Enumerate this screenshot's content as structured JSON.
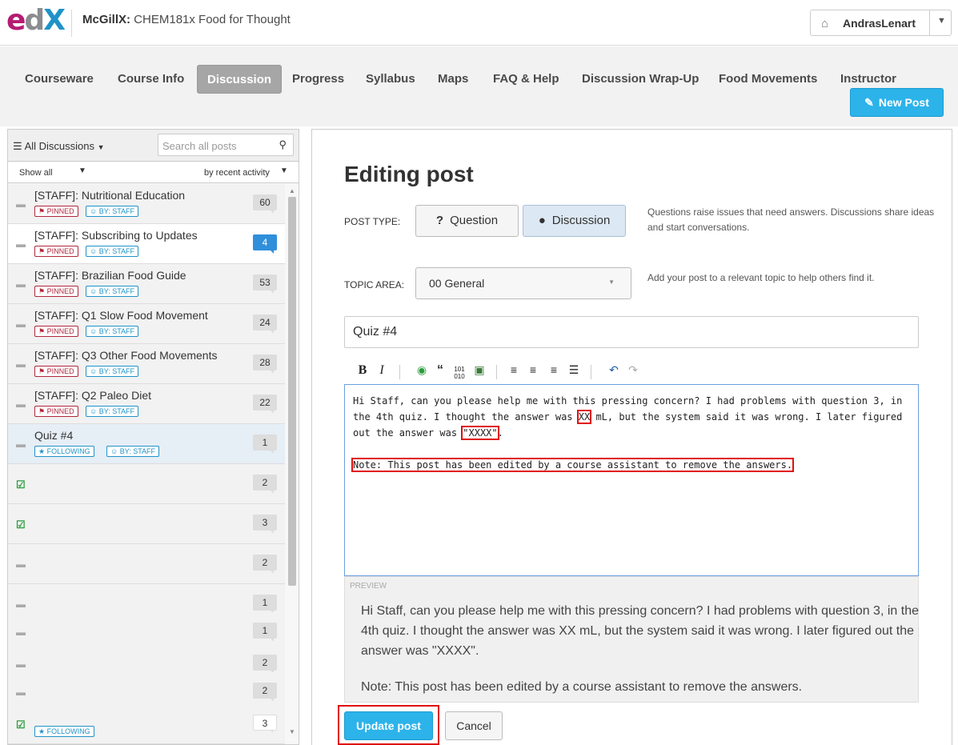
{
  "header": {
    "logo": {
      "e": "e",
      "d": "d",
      "x": "X"
    },
    "course_org": "McGillX:",
    "course_name": " CHEM181x Food for Thought",
    "user": "AndrasLenart"
  },
  "nav": {
    "tabs": [
      "Courseware",
      "Course Info",
      "Discussion",
      "Progress",
      "Syllabus",
      "Maps",
      "FAQ & Help",
      "Discussion Wrap-Up",
      "Food Movements",
      "Instructor"
    ],
    "active": "Discussion",
    "new_post": "New Post"
  },
  "sidebar": {
    "menu_label": "All Discussions",
    "search_placeholder": "Search all posts",
    "show_label": "Show all",
    "sort_label": "by recent activity",
    "threads": [
      {
        "title": "[STAFF]: Nutritional Education",
        "count": "60",
        "badges": [
          "PINNED",
          "BY: STAFF"
        ]
      },
      {
        "title": "[STAFF]: Subscribing to Updates",
        "count": "4",
        "badges": [
          "PINNED",
          "BY: STAFF"
        ]
      },
      {
        "title": "[STAFF]: Brazilian Food Guide",
        "count": "53",
        "badges": [
          "PINNED",
          "BY: STAFF"
        ]
      },
      {
        "title": "[STAFF]: Q1 Slow Food Movement",
        "count": "24",
        "badges": [
          "PINNED",
          "BY: STAFF"
        ]
      },
      {
        "title": "[STAFF]: Q3 Other Food Movements",
        "count": "28",
        "badges": [
          "PINNED",
          "BY: STAFF"
        ]
      },
      {
        "title": "[STAFF]: Q2 Paleo Diet",
        "count": "22",
        "badges": [
          "PINNED",
          "BY: STAFF"
        ]
      },
      {
        "title": "Quiz #4",
        "count": "1",
        "badges": [
          "FOLLOWING",
          "BY: STAFF"
        ]
      },
      {
        "title": "",
        "count": "2",
        "badges": []
      },
      {
        "title": "",
        "count": "3",
        "badges": []
      },
      {
        "title": "",
        "count": "2",
        "badges": []
      },
      {
        "title": "",
        "count": "1",
        "badges": []
      },
      {
        "title": "",
        "count": "1",
        "badges": []
      },
      {
        "title": "",
        "count": "2",
        "badges": []
      },
      {
        "title": "",
        "count": "2",
        "badges": []
      },
      {
        "title": "",
        "count": "3",
        "badges": [
          "FOLLOWING"
        ]
      }
    ]
  },
  "editor": {
    "heading": "Editing post",
    "post_type_label": "POST TYPE:",
    "question_label": "Question",
    "discussion_label": "Discussion",
    "post_type_help": "Questions raise issues that need answers. Discussions share ideas and start conversations.",
    "topic_label": "TOPIC AREA:",
    "topic_value": "00 General",
    "topic_help": "Add your post to a relevant topic to help others find it.",
    "title_value": "Quiz #4",
    "body_p1_a": "Hi Staff, can you please help me with this pressing concern? I had problems with question 3, in the 4th quiz. I thought the answer was ",
    "body_p1_b": "XX",
    "body_p1_c": " mL, but the system said it was wrong. I later figured out the answer was ",
    "body_p1_d": "\"XXXX\"",
    "body_p1_e": ".",
    "body_p2": "Note: This post has been edited by a course assistant to remove the answers.",
    "preview_label": "PREVIEW",
    "preview_p1": "Hi Staff, can you please help me with this pressing concern? I had problems with question 3, in the 4th quiz. I thought the answer was XX mL, but the system said it was wrong. I later figured out the answer was \"XXXX\".",
    "preview_p2": "Note: This post has been edited by a course assistant to remove the answers.",
    "update_label": "Update post",
    "cancel_label": "Cancel"
  }
}
